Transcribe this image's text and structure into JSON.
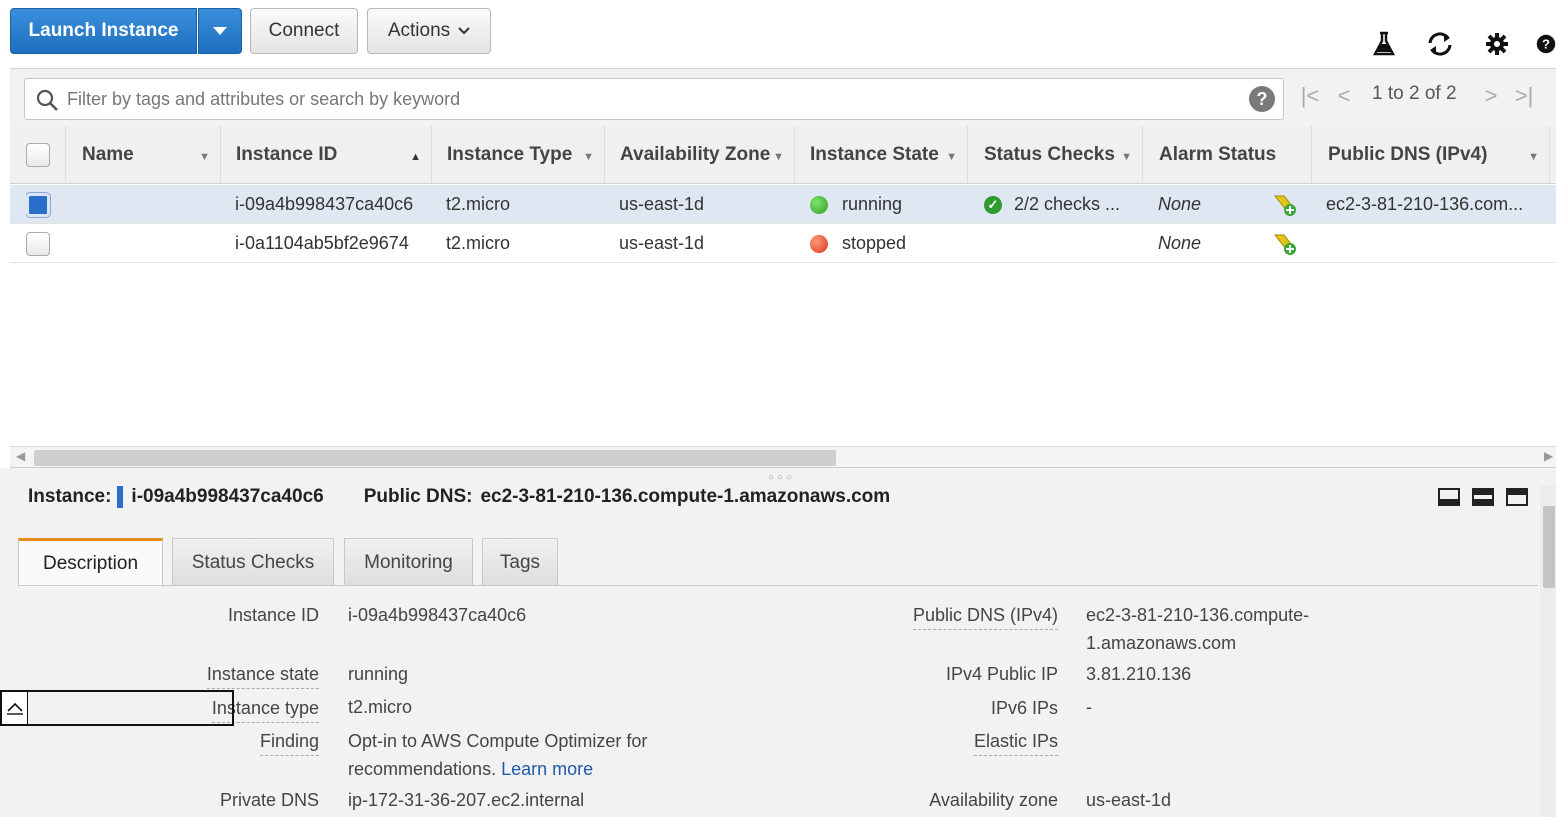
{
  "toolbar": {
    "launch_label": "Launch Instance",
    "connect_label": "Connect",
    "actions_label": "Actions"
  },
  "search": {
    "placeholder": "Filter by tags and attributes or search by keyword",
    "help": "?",
    "pager_text": "1 to 2 of 2"
  },
  "table": {
    "columns": [
      "Name",
      "Instance ID",
      "Instance Type",
      "Availability Zone",
      "Instance State",
      "Status Checks",
      "Alarm Status",
      "Public DNS (IPv4)"
    ],
    "rows": [
      {
        "name": "",
        "instance_id": "i-09a4b998437ca40c6",
        "instance_type": "t2.micro",
        "zone": "us-east-1d",
        "state": "running",
        "state_color": "#2fa023",
        "status_checks": "2/2 checks ...",
        "alarm": "None",
        "public_dns": "ec2-3-81-210-136.com...",
        "selected": true
      },
      {
        "name": "",
        "instance_id": "i-0a1104ab5bf2e9674",
        "instance_type": "t2.micro",
        "zone": "us-east-1d",
        "state": "stopped",
        "state_color": "#d9361c",
        "status_checks": "",
        "alarm": "None",
        "public_dns": "",
        "selected": false
      }
    ]
  },
  "details": {
    "instance_label": "Instance:",
    "instance_id": "i-09a4b998437ca40c6",
    "dns_label": "Public DNS:",
    "dns_value": "ec2-3-81-210-136.compute-1.amazonaws.com",
    "tabs": [
      "Description",
      "Status Checks",
      "Monitoring",
      "Tags"
    ],
    "left": [
      {
        "label": "Instance ID",
        "value": "i-09a4b998437ca40c6"
      },
      {
        "label": "Instance state",
        "value": "running"
      },
      {
        "label": "Instance type",
        "value": "t2.micro"
      },
      {
        "label": "Finding",
        "value": "Opt-in to AWS Compute Optimizer for recommendations.",
        "link": "Learn more"
      },
      {
        "label": "Private DNS",
        "value": "ip-172-31-36-207.ec2.internal"
      }
    ],
    "right": [
      {
        "label": "Public DNS (IPv4)",
        "value_line1": "ec2-3-81-210-136.compute-",
        "value_line2": "1.amazonaws.com"
      },
      {
        "label": "IPv4 Public IP",
        "value": "3.81.210.136"
      },
      {
        "label": "IPv6 IPs",
        "value": "-"
      },
      {
        "label": "Elastic IPs",
        "value": ""
      },
      {
        "label": "Availability zone",
        "value": "us-east-1d"
      }
    ]
  },
  "colors": {
    "primary_button": "#1f6fbf",
    "active_tab_accent": "#e88b1a",
    "link": "#1f5ba8",
    "selected_row": "#dfe7f2"
  },
  "icons": [
    "caret-down-icon",
    "flask-icon",
    "refresh-icon",
    "gear-icon",
    "help-icon",
    "search-icon",
    "first-page-icon",
    "prev-page-icon",
    "next-page-icon",
    "last-page-icon",
    "alarm-add-icon",
    "panel-view-icon"
  ]
}
